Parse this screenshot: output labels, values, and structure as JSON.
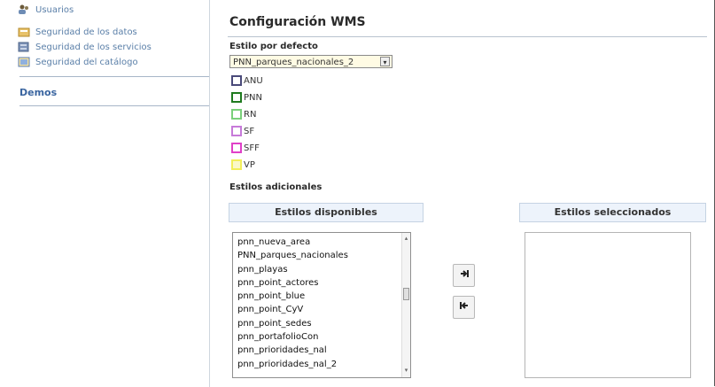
{
  "sidebar": {
    "items": [
      {
        "label": "Usuarios",
        "icon": "users-icon"
      },
      {
        "label": "Seguridad de los datos",
        "icon": "data-security-icon"
      },
      {
        "label": "Seguridad de los servicios",
        "icon": "services-security-icon"
      },
      {
        "label": "Seguridad del catálogo",
        "icon": "catalog-security-icon"
      }
    ],
    "demos_label": "Demos"
  },
  "wms": {
    "title": "Configuración WMS",
    "default_style_label": "Estilo por defecto",
    "default_style_value": "PNN_parques_nacionales_2",
    "legend": [
      {
        "label": "ANU",
        "color": "#4a4a7a"
      },
      {
        "label": "PNN",
        "color": "#1f7a1f"
      },
      {
        "label": "RN",
        "color": "#7ad07a"
      },
      {
        "label": "SF",
        "color": "#c77ad9"
      },
      {
        "label": "SFF",
        "color": "#e040c8"
      },
      {
        "label": "VP",
        "color": "#f2ee5a"
      }
    ],
    "additional_styles_label": "Estilos adicionales",
    "available_header": "Estilos disponibles",
    "selected_header": "Estilos seleccionados",
    "available_items": [
      "pnn_nueva_area",
      "PNN_parques_nacionales",
      "pnn_playas",
      "pnn_point_actores",
      "pnn_point_blue",
      "pnn_point_CyV",
      "pnn_point_sedes",
      "pnn_portafolioCon",
      "pnn_prioridades_nal",
      "pnn_prioridades_nal_2"
    ],
    "selected_items": []
  }
}
